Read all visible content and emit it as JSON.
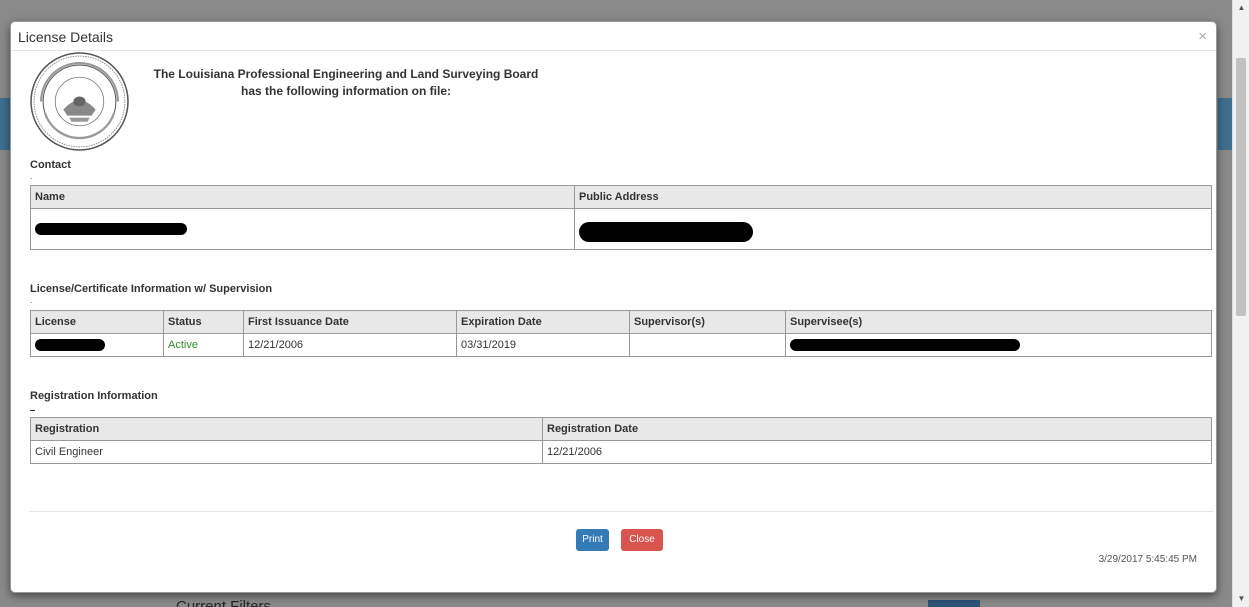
{
  "background": {
    "filters_label": "Current Filters"
  },
  "modal": {
    "title": "License Details",
    "close_glyph": "×",
    "board_line1": "The Louisiana Professional Engineering and Land Surveying Board",
    "board_line2": "has the following information on file:",
    "seal_icon": "louisiana-state-seal-icon"
  },
  "contact": {
    "section_title": "Contact",
    "dot": ".",
    "headers": [
      "Name",
      "Public Address"
    ]
  },
  "license": {
    "section_title": "License/Certificate Information w/ Supervision",
    "dot": ".",
    "headers": [
      "License",
      "Status",
      "First Issuance Date",
      "Expiration Date",
      "Supervisor(s)",
      "Supervisee(s)"
    ],
    "row": {
      "status": "Active",
      "first_issuance": "12/21/2006",
      "expiration": "03/31/2019",
      "supervisors": ""
    }
  },
  "registration": {
    "section_title": "Registration Information",
    "headers": [
      "Registration",
      "Registration Date"
    ],
    "row": {
      "registration": "Civil Engineer",
      "date": "12/21/2006"
    }
  },
  "footer": {
    "print_label": "Print",
    "close_label": "Close",
    "timestamp": "3/29/2017 5:45:45 PM"
  },
  "colors": {
    "print": "#337ab7",
    "close": "#d9534f",
    "active_status": "#2e8b2e"
  }
}
